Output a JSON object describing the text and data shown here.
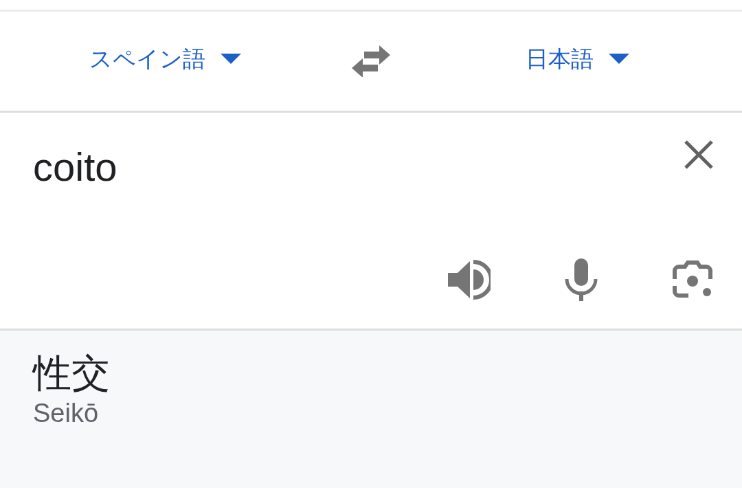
{
  "languages": {
    "source": {
      "label": "スペイン語"
    },
    "target": {
      "label": "日本語"
    }
  },
  "input": {
    "value": "coito"
  },
  "output": {
    "translation": "性交",
    "romanization": "Seikō"
  }
}
